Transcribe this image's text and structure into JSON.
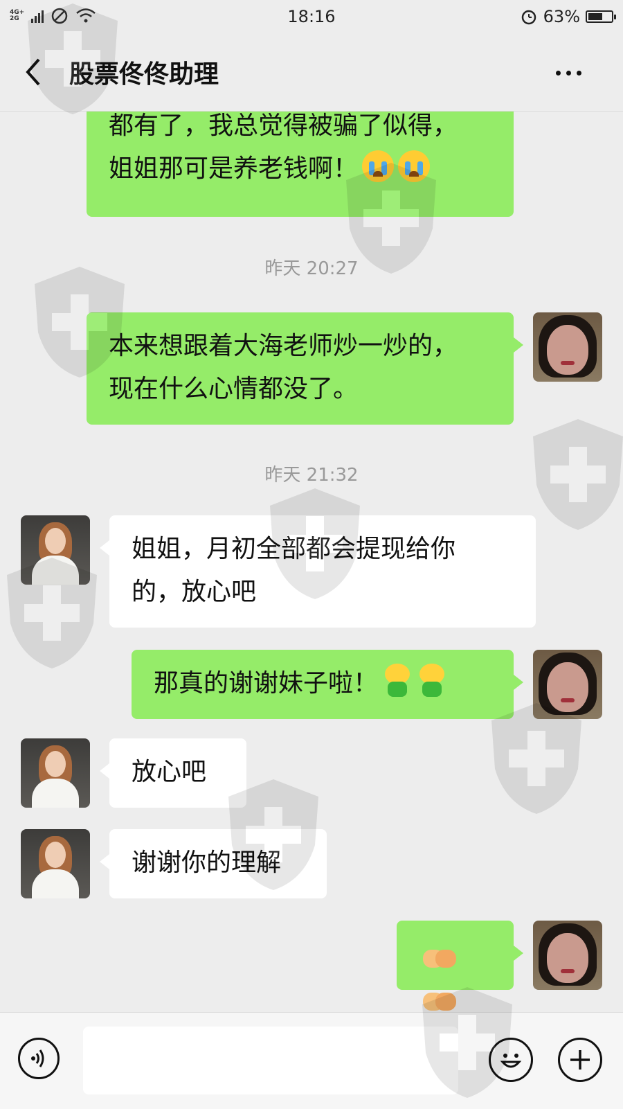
{
  "status_bar": {
    "network_top": "4G+",
    "network_bottom": "2G",
    "time": "18:16",
    "battery_percent": "63%",
    "battery_level": 0.63
  },
  "header": {
    "title": "股票佟佟助理"
  },
  "messages": [
    {
      "side": "out",
      "lines": [
        "都有了，我总觉得被骗了似得，",
        "姐姐那可是养老钱啊！"
      ],
      "emoji": "crying-face"
    },
    {
      "type": "timestamp",
      "text": "昨天 20:27"
    },
    {
      "side": "out",
      "lines": [
        "本来想跟着大海老师炒一炒的，",
        "现在什么心情都没了。"
      ]
    },
    {
      "type": "timestamp",
      "text": "昨天 21:32"
    },
    {
      "side": "in",
      "lines": [
        "姐姐，月初全部都会提现给你",
        "的，放心吧"
      ]
    },
    {
      "side": "out",
      "lines": [
        "那真的谢谢妹子啦！"
      ],
      "emoji": "frog"
    },
    {
      "side": "in",
      "lines": [
        "放心吧"
      ]
    },
    {
      "side": "in",
      "lines": [
        "谢谢你的理解"
      ]
    },
    {
      "side": "out",
      "lines": [
        ""
      ],
      "emoji": "handshake"
    }
  ],
  "input_bar": {
    "value": "",
    "voice_icon": "voice-icon",
    "emoji_icon": "emoji-icon",
    "plus_icon": "plus-icon"
  },
  "colors": {
    "background": "#ededed",
    "outgoing_bubble": "#95ec69",
    "incoming_bubble": "#ffffff",
    "timestamp_text": "#999999"
  }
}
